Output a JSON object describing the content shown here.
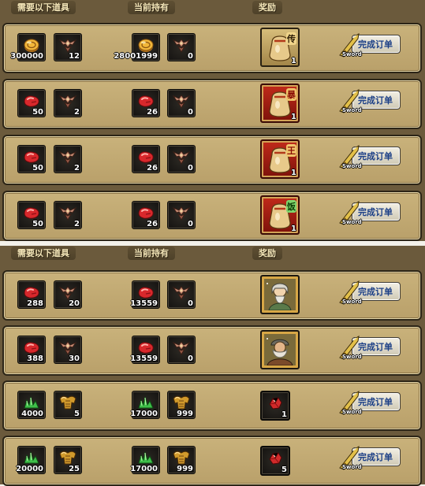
{
  "headers": {
    "required": "需要以下道具",
    "current": "当前持有",
    "reward": "奖励"
  },
  "button": {
    "label": "完成订单",
    "sub": "Sword"
  },
  "rows": [
    {
      "req": [
        {
          "icon": "coin-icon",
          "count": "300000"
        },
        {
          "icon": "wing-crest-icon",
          "count": "12"
        }
      ],
      "have": [
        {
          "icon": "coin-icon",
          "count": "28001999"
        },
        {
          "icon": "wing-crest-icon",
          "count": "0"
        }
      ],
      "reward": {
        "icon": "rice-bag-icon",
        "tag": "传",
        "count": "1",
        "style": "gold"
      }
    },
    {
      "req": [
        {
          "icon": "red-gem-icon",
          "count": "50"
        },
        {
          "icon": "wing-crest-icon",
          "count": "2"
        }
      ],
      "have": [
        {
          "icon": "red-gem-icon",
          "count": "26"
        },
        {
          "icon": "wing-crest-icon",
          "count": "0"
        }
      ],
      "reward": {
        "icon": "rice-bag-icon",
        "tag": "暴",
        "count": "1",
        "style": "red"
      }
    },
    {
      "req": [
        {
          "icon": "red-gem-icon",
          "count": "50"
        },
        {
          "icon": "wing-crest-icon",
          "count": "2"
        }
      ],
      "have": [
        {
          "icon": "red-gem-icon",
          "count": "26"
        },
        {
          "icon": "wing-crest-icon",
          "count": "0"
        }
      ],
      "reward": {
        "icon": "rice-bag-icon",
        "tag": "王",
        "count": "1",
        "style": "red"
      }
    },
    {
      "req": [
        {
          "icon": "red-gem-icon",
          "count": "50"
        },
        {
          "icon": "wing-crest-icon",
          "count": "2"
        }
      ],
      "have": [
        {
          "icon": "red-gem-icon",
          "count": "26"
        },
        {
          "icon": "wing-crest-icon",
          "count": "0"
        }
      ],
      "reward": {
        "icon": "rice-bag-icon",
        "tag": "饭",
        "count": "1",
        "style": "red green"
      }
    },
    {
      "req": [
        {
          "icon": "red-gem-icon",
          "count": "288"
        },
        {
          "icon": "wing-crest-icon",
          "count": "20"
        }
      ],
      "have": [
        {
          "icon": "red-gem-icon",
          "count": "13559"
        },
        {
          "icon": "wing-crest-icon",
          "count": "0"
        }
      ],
      "reward": {
        "icon": "sage-portrait-icon",
        "tag": "",
        "count": "",
        "style": "frame"
      }
    },
    {
      "req": [
        {
          "icon": "red-gem-icon",
          "count": "388"
        },
        {
          "icon": "wing-crest-icon",
          "count": "30"
        }
      ],
      "have": [
        {
          "icon": "red-gem-icon",
          "count": "13559"
        },
        {
          "icon": "wing-crest-icon",
          "count": "0"
        }
      ],
      "reward": {
        "icon": "dwarf-portrait-icon",
        "tag": "",
        "count": "",
        "style": "frame"
      }
    },
    {
      "req": [
        {
          "icon": "green-crystal-icon",
          "count": "4000"
        },
        {
          "icon": "gold-armor-icon",
          "count": "5"
        }
      ],
      "have": [
        {
          "icon": "green-crystal-icon",
          "count": "17000"
        },
        {
          "icon": "gold-armor-icon",
          "count": "999"
        }
      ],
      "reward": {
        "icon": "red-ore-icon",
        "tag": "",
        "count": "1",
        "style": "dark"
      }
    },
    {
      "req": [
        {
          "icon": "green-crystal-icon",
          "count": "20000"
        },
        {
          "icon": "gold-armor-icon",
          "count": "25"
        }
      ],
      "have": [
        {
          "icon": "green-crystal-icon",
          "count": "17000"
        },
        {
          "icon": "gold-armor-icon",
          "count": "999"
        }
      ],
      "reward": {
        "icon": "red-ore-icon",
        "tag": "",
        "count": "5",
        "style": "dark"
      }
    }
  ]
}
